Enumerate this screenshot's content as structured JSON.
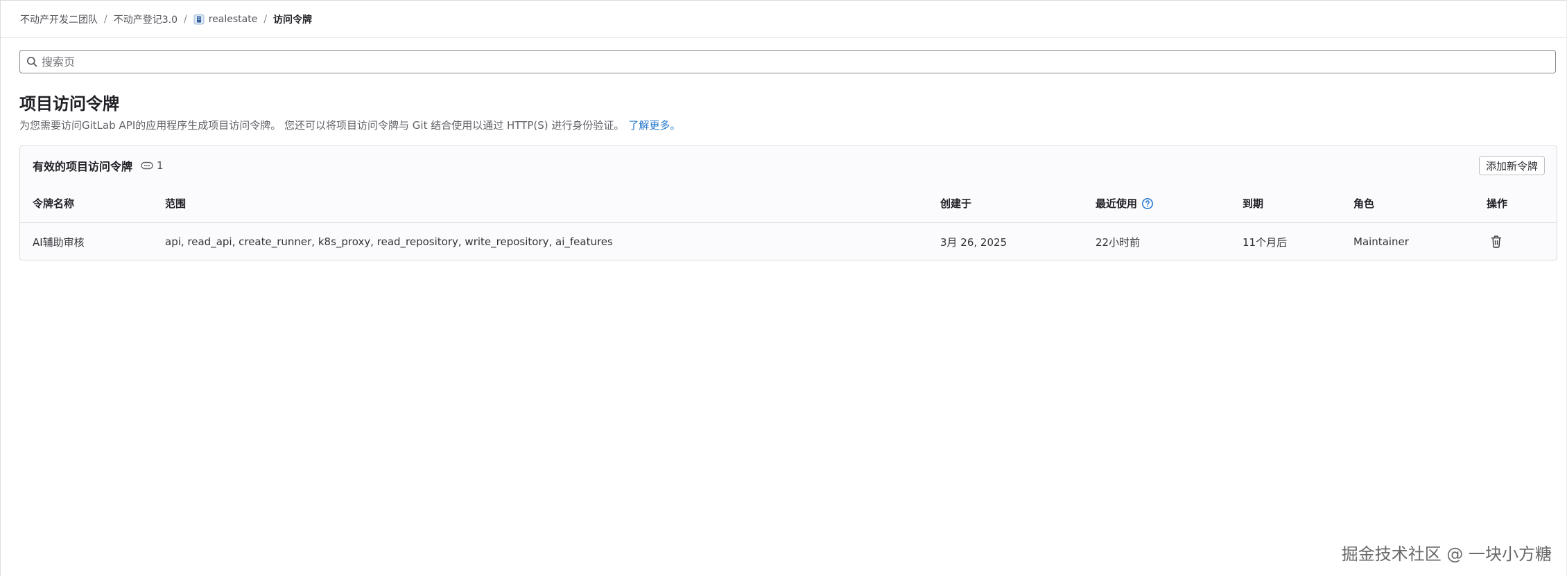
{
  "breadcrumb": {
    "items": [
      "不动产开发二团队",
      "不动产登记3.0",
      "realestate",
      "访问令牌"
    ],
    "separator": "/"
  },
  "search": {
    "placeholder": "搜索页",
    "value": ""
  },
  "page": {
    "title": "项目访问令牌",
    "description": "为您需要访问GitLab API的应用程序生成项目访问令牌。 您还可以将项目访问令牌与 Git 结合使用以通过 HTTP(S) 进行身份验证。",
    "learn_more": "了解更多。"
  },
  "tokens_card": {
    "title": "有效的项目访问令牌",
    "count": "1",
    "add_button": "添加新令牌",
    "columns": [
      "令牌名称",
      "范围",
      "创建于",
      "最近使用",
      "到期",
      "角色",
      "操作"
    ],
    "rows": [
      {
        "name": "AI辅助审核",
        "scopes": "api, read_api, create_runner, k8s_proxy, read_repository, write_repository, ai_features",
        "created": "3月 26, 2025",
        "last_used": "22小时前",
        "expires": "11个月后",
        "role": "Maintainer"
      }
    ]
  },
  "watermark": "掘金技术社区 @ 一块小方糖",
  "colors": {
    "link": "#1f75cb",
    "border": "#dcdcde",
    "card_bg": "#fbfafd"
  },
  "icons": {
    "project": "project-avatar-icon",
    "search": "search-icon",
    "count": "token-icon",
    "help": "question-circle-icon",
    "delete": "trash-icon"
  }
}
